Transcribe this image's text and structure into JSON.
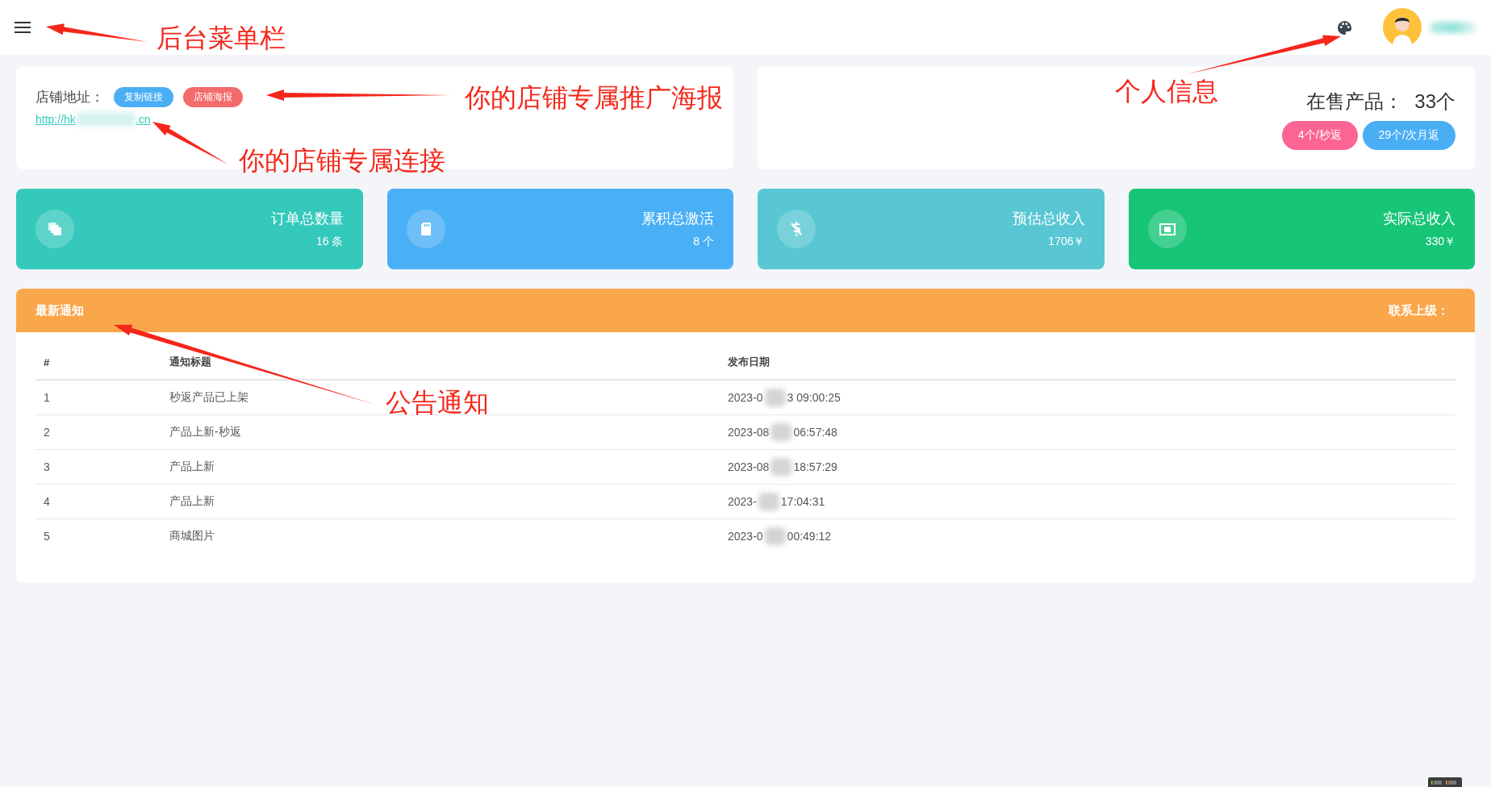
{
  "store_card": {
    "label": "店铺地址：",
    "buttons": [
      {
        "label": "复制链接",
        "color": "#4aaef5"
      },
      {
        "label": "店铺海报",
        "color": "#f36b6b"
      }
    ],
    "link_prefix": "http://hk",
    "link_suffix": ".cn"
  },
  "products_card": {
    "label": "在售产品：",
    "count": "33个",
    "tags": [
      {
        "label": "4个/秒返",
        "color": "#fb6493"
      },
      {
        "label": "29个/次月返",
        "color": "#4aaef5"
      }
    ]
  },
  "stats": [
    {
      "kind": "copy",
      "title": "订单总数量",
      "value": "16 条",
      "color": "#35c9bc"
    },
    {
      "kind": "card",
      "title": "累积总激活",
      "value": "8 个",
      "color": "#4ab0f6"
    },
    {
      "kind": "dollar-off",
      "title": "预估总收入",
      "value": "1706￥",
      "color": "#58c7d3"
    },
    {
      "kind": "bill",
      "title": "实际总收入",
      "value": "330￥",
      "color": "#16c576"
    }
  ],
  "notice": {
    "title": "最新通知",
    "contact": "联系上级：",
    "columns": [
      "#",
      "通知标题",
      "发布日期"
    ],
    "rows": [
      {
        "index": "1",
        "title": "秒返产品已上架",
        "date_start": "2023-0",
        "date_end": "3 09:00:25"
      },
      {
        "index": "2",
        "title": "产品上新-秒返",
        "date_start": "2023-08",
        "date_end": "06:57:48"
      },
      {
        "index": "3",
        "title": "产品上新",
        "date_start": "2023-08",
        "date_end": "18:57:29"
      },
      {
        "index": "4",
        "title": "产品上新",
        "date_start": "2023-",
        "date_end": "17:04:31"
      },
      {
        "index": "5",
        "title": "商城图片",
        "date_start": "2023-0",
        "date_end": "00:49:12"
      }
    ]
  },
  "annotations": [
    {
      "text": "后台菜单栏"
    },
    {
      "text": "你的店铺专属推广海报"
    },
    {
      "text": "你的店铺专属连接"
    },
    {
      "text": "个人信息"
    },
    {
      "text": "公告通知"
    }
  ]
}
